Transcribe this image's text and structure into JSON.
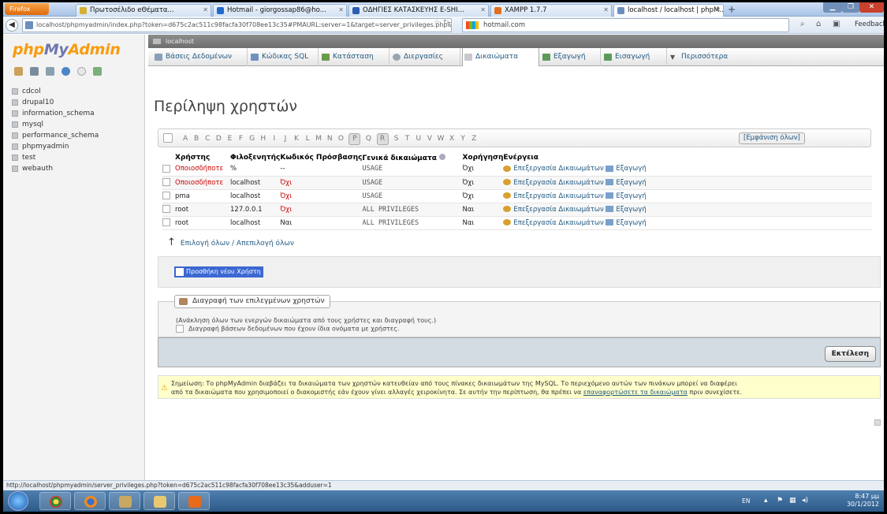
{
  "browser": {
    "menu_button": "Firefox",
    "tabs": [
      {
        "title": "Πρωτοσέλιδο eΘέματα...",
        "active": false,
        "icon_color": "#d6b030"
      },
      {
        "title": "Πρωτοσέλιδο eΘέματα-... × | Hotmail - giorgossap86@ho...",
        "active": false,
        "icon_color": "#1f6bcc"
      },
      {
        "title": "ΟΔΗΓΙΕΣ ΚΑΤΑΣΚΕΥΗΣ Ε-SHI...",
        "active": false,
        "icon_color": "#2a5fb0"
      },
      {
        "title": "XAMPP 1.7.7",
        "active": false,
        "icon_color": "#e07020"
      },
      {
        "title": "localhost / localhost | phpM...",
        "active": true,
        "icon_color": "#6c8ebf"
      }
    ],
    "new_tab": "+",
    "url": "localhost/phpmyadmin/index.php?token=d675c2ac511c98facfa30f708ee13c35#PMAURL:server=1&target=server_privileges.php&token=d",
    "search_value": "hotmail.com",
    "feedback": "Feedback",
    "status_url": "http://localhost/phpmyadmin/server_privileges.php?token=d675c2ac511c98facfa30f708ee13c35&adduser=1"
  },
  "pma": {
    "logo_php": "php",
    "logo_my": "My",
    "logo_admin": "Admin",
    "server_label": "localhost",
    "databases": [
      "cdcol",
      "drupal10",
      "information_schema",
      "mysql",
      "performance_schema",
      "phpmyadmin",
      "test",
      "webauth"
    ],
    "tabs": [
      {
        "label": "Βάσεις Δεδομένων",
        "icon_color": "#8aa0b8"
      },
      {
        "label": "Κώδικας SQL",
        "icon_color": "#7090c0"
      },
      {
        "label": "Κατάσταση",
        "icon_color": "#6b9b4a"
      },
      {
        "label": "Διεργασίες",
        "icon_color": "#9aa4ae"
      },
      {
        "label": "Δικαιώματα",
        "icon_color": "#c8c8d0"
      },
      {
        "label": "Εξαγωγή",
        "icon_color": "#5c9a5c"
      },
      {
        "label": "Εισαγωγή",
        "icon_color": "#5c9a5c"
      },
      {
        "label": "Περισσότερα",
        "icon_color": "#777777"
      }
    ],
    "page_title": "Περίληψη χρηστών",
    "letters": [
      "A",
      "B",
      "C",
      "D",
      "E",
      "F",
      "G",
      "H",
      "I",
      "J",
      "K",
      "L",
      "M",
      "N",
      "O",
      "P",
      "Q",
      "R",
      "S",
      "T",
      "U",
      "V",
      "W",
      "X",
      "Y",
      "Z"
    ],
    "selected_letters": [
      "P",
      "R"
    ],
    "show_all": "[Εμφάνιση όλων]",
    "columns": [
      "Χρήστης",
      "Φιλοξενητής",
      "Κωδικός Πρόσβασης",
      "Γενικά δικαιώματα",
      "Χορήγηση",
      "Ενέργεια"
    ],
    "users": [
      {
        "user": "Οποιοσδήποτε",
        "host": "%",
        "password": "--",
        "privileges": "USAGE",
        "grant": "Όχι"
      },
      {
        "user": "Οποιοσδήποτε",
        "host": "localhost",
        "password": "Όχι",
        "privileges": "USAGE",
        "grant": "Όχι"
      },
      {
        "user": "pma",
        "host": "localhost",
        "password": "Όχι",
        "privileges": "USAGE",
        "grant": "Όχι"
      },
      {
        "user": "root",
        "host": "127.0.0.1",
        "password": "Όχι",
        "privileges": "ALL PRIVILEGES",
        "grant": "Ναι"
      },
      {
        "user": "root",
        "host": "localhost",
        "password": "Ναι",
        "privileges": "ALL PRIVILEGES",
        "grant": "Ναι"
      }
    ],
    "edit_privileges": "Επεξεργασία Δικαιωμάτων",
    "export": "Εξαγωγή",
    "check_all": "Επιλογή όλων / Απεπιλογή όλων",
    "add_user": "Προσθήκη νέου Χρήστη",
    "delete_legend": "Διαγραφή των επιλεγμένων χρηστών",
    "delete_note": "(Ανάκληση όλων των ενεργών δικαιώματα από τους χρήστες και διαγραφή τους.)",
    "delete_option": "Διαγραφή βάσεων δεδομένων που έχουν ίδια ονόματα με χρήστες.",
    "execute": "Εκτέλεση",
    "notice_line1": "Σημείωση: Το phpMyAdmin διαβάζει τα δικαιώματα των χρηστών κατευθείαν από τους πίνακες δικαιωμάτων της MySQL. Το περιεχόμενο αυτών των πινάκων μπορεί να διαφέρει",
    "notice_line2": "από τα δικαιώματα που χρησιμοποιεί ο διακομιστής εάν έχουν γίνει αλλαγές χειροκίνητα. Σε αυτήν την περίπτωση, θα πρέπει να",
    "notice_link": "επαναφορτώσετε τα δικαιώματα",
    "notice_end": "πριν συνεχίσετε."
  },
  "taskbar": {
    "lang": "EN",
    "time": "8:47 μμ",
    "date": "30/1/2012"
  }
}
